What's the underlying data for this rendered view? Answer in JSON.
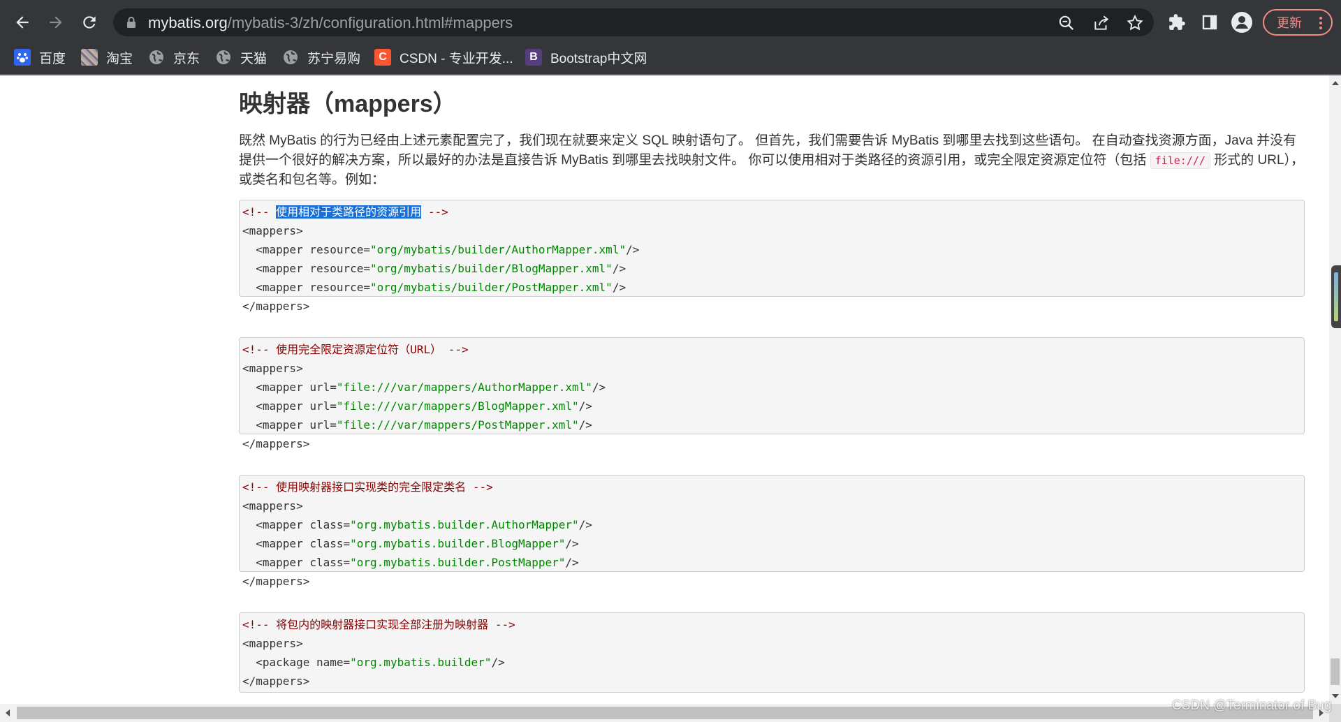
{
  "browser": {
    "url_host": "mybatis.org",
    "url_path": "/mybatis-3/zh/configuration.html#mappers",
    "update_label": "更新",
    "accent": "#f28b82"
  },
  "bookmarks": [
    {
      "label": "百度",
      "icon": "baidu-paw-icon",
      "color": "#2f65f0"
    },
    {
      "label": "淘宝",
      "icon": "taobao-icon",
      "color": "#888888"
    },
    {
      "label": "京东",
      "icon": "globe-icon",
      "color": "#9aa0a6"
    },
    {
      "label": "天猫",
      "icon": "globe-icon",
      "color": "#9aa0a6"
    },
    {
      "label": "苏宁易购",
      "icon": "globe-icon",
      "color": "#9aa0a6"
    },
    {
      "label": "CSDN - 专业开发...",
      "icon": "csdn-icon",
      "color": "#fc5531"
    },
    {
      "label": "Bootstrap中文网",
      "icon": "bootstrap-icon",
      "color": "#563d7c"
    }
  ],
  "page": {
    "title": "映射器（mappers）",
    "desc_part1": "既然 MyBatis 的行为已经由上述元素配置完了，我们现在就要来定义 SQL 映射语句了。 但首先，我们需要告诉 MyBatis 到哪里去找到这些语句。 在自动查找资源方面，Java 并没有提供一个很好的解决方案，所以最好的办法是直接告诉 MyBatis 到哪里去找映射文件。 你可以使用相对于类路径的资源引用，或完全限定资源定位符（包括 ",
    "desc_code": "file:///",
    "desc_part2": " 形式的 URL），或类名和包名等。例如：",
    "code_blocks": [
      {
        "comment_open": "<!-- ",
        "comment_text": "使用相对于类路径的资源引用",
        "comment_close": " -->",
        "highlight_comment": true,
        "open_tag": "<mappers>",
        "lines": [
          {
            "prefix": "  <mapper ",
            "attr": "resource",
            "eq": "=",
            "value": "\"org/mybatis/builder/AuthorMapper.xml\"",
            "suffix": "/>"
          },
          {
            "prefix": "  <mapper ",
            "attr": "resource",
            "eq": "=",
            "value": "\"org/mybatis/builder/BlogMapper.xml\"",
            "suffix": "/>"
          },
          {
            "prefix": "  <mapper ",
            "attr": "resource",
            "eq": "=",
            "value": "\"org/mybatis/builder/PostMapper.xml\"",
            "suffix": "/>"
          }
        ],
        "close_tag": "</mappers>"
      },
      {
        "comment_open": "<!-- ",
        "comment_text": "使用完全限定资源定位符（URL）",
        "comment_close": " -->",
        "highlight_comment": false,
        "open_tag": "<mappers>",
        "lines": [
          {
            "prefix": "  <mapper ",
            "attr": "url",
            "eq": "=",
            "value": "\"file:///var/mappers/AuthorMapper.xml\"",
            "suffix": "/>"
          },
          {
            "prefix": "  <mapper ",
            "attr": "url",
            "eq": "=",
            "value": "\"file:///var/mappers/BlogMapper.xml\"",
            "suffix": "/>"
          },
          {
            "prefix": "  <mapper ",
            "attr": "url",
            "eq": "=",
            "value": "\"file:///var/mappers/PostMapper.xml\"",
            "suffix": "/>"
          }
        ],
        "close_tag": "</mappers>"
      },
      {
        "comment_open": "<!-- ",
        "comment_text": "使用映射器接口实现类的完全限定类名",
        "comment_close": " -->",
        "highlight_comment": false,
        "open_tag": "<mappers>",
        "lines": [
          {
            "prefix": "  <mapper ",
            "attr": "class",
            "eq": "=",
            "value": "\"org.mybatis.builder.AuthorMapper\"",
            "suffix": "/>"
          },
          {
            "prefix": "  <mapper ",
            "attr": "class",
            "eq": "=",
            "value": "\"org.mybatis.builder.BlogMapper\"",
            "suffix": "/>"
          },
          {
            "prefix": "  <mapper ",
            "attr": "class",
            "eq": "=",
            "value": "\"org.mybatis.builder.PostMapper\"",
            "suffix": "/>"
          }
        ],
        "close_tag": "</mappers>"
      },
      {
        "comment_open": "<!-- ",
        "comment_text": "将包内的映射器接口实现全部注册为映射器",
        "comment_close": " -->",
        "highlight_comment": false,
        "open_tag": "<mappers>",
        "lines": [
          {
            "prefix": "  <package ",
            "attr": "name",
            "eq": "=",
            "value": "\"org.mybatis.builder\"",
            "suffix": "/>"
          }
        ],
        "close_tag": "</mappers>"
      }
    ]
  },
  "watermark": "CSDN @Terminator of Bug"
}
